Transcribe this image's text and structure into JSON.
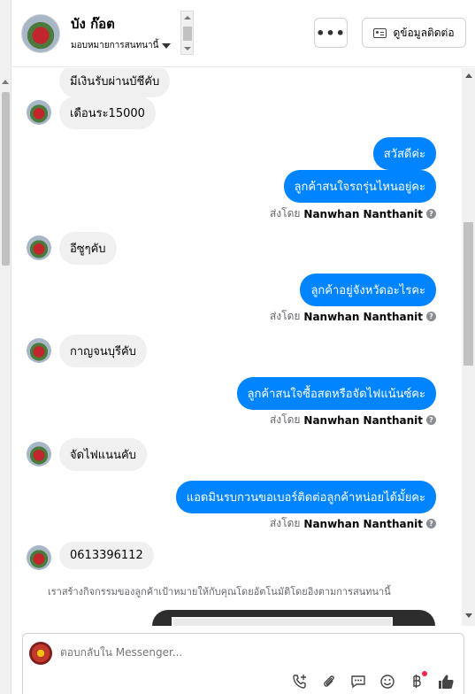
{
  "header": {
    "name": "บัง ก๊อต",
    "assign_label": "มอบหมายการสนทนานี้",
    "more_label": "•••",
    "contact_label": "ดูข้อมูลติดต่อ"
  },
  "messages": [
    {
      "dir": "in",
      "text": "มีเงินรับผ่านบัชีคับ"
    },
    {
      "dir": "in",
      "text": "เดือนระ15000"
    },
    {
      "dir": "out",
      "text": "สวัสดีค่ะ"
    },
    {
      "dir": "out",
      "text": "ลูกค้าสนใจรถรุ่นไหนอยู่คะ"
    },
    {
      "dir": "in",
      "text": "อีซูๆคับ"
    },
    {
      "dir": "out",
      "text": "ลูกค้าอยู่จังหวัดอะไรคะ"
    },
    {
      "dir": "in",
      "text": "กาญจนบุรีคับ"
    },
    {
      "dir": "out",
      "text": "ลูกค้าสนใจซื้อสดหรือจัดไฟแน้นซ์คะ"
    },
    {
      "dir": "in",
      "text": "จัดไฟแนนคับ"
    },
    {
      "dir": "out",
      "text": "แอดมินรบกวนขอเบอร์ติดต่อลูกค้าหน่อยได้มั้ยคะ"
    },
    {
      "dir": "in",
      "text": "0613396112"
    }
  ],
  "sent_by": {
    "prefix": "ส่งโดย",
    "name": "Nanwhan Nanthanit",
    "help": "?"
  },
  "notice": "เราสร้างกิจกรรมของลูกค้าเป้าหมายให้กับคุณโดยอัตโนมัติโดยอิงตามการสนทนานี้",
  "composer": {
    "placeholder": "ตอบกลับใน Messenger..."
  },
  "icons": [
    "phone-plus-icon",
    "paperclip-icon",
    "chat-bubble-icon",
    "smile-icon",
    "baht-icon",
    "thumbs-up-icon"
  ],
  "colors": {
    "outgoing_bubble": "#0084ff",
    "incoming_bubble": "#f0f0f0",
    "notification_dot": "#f02849"
  }
}
